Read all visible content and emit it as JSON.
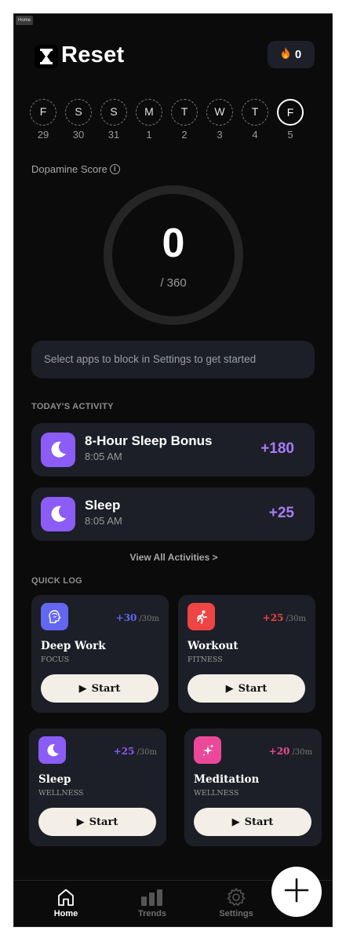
{
  "window_tag": "Home",
  "header": {
    "title": "Reset",
    "streak_count": "0",
    "streak_icon": "fire-icon",
    "logo_icon": "hourglass-icon"
  },
  "week": [
    {
      "letter": "F",
      "date": "29",
      "active": false
    },
    {
      "letter": "S",
      "date": "30",
      "active": false
    },
    {
      "letter": "S",
      "date": "31",
      "active": false
    },
    {
      "letter": "M",
      "date": "1",
      "active": false
    },
    {
      "letter": "T",
      "date": "2",
      "active": false
    },
    {
      "letter": "W",
      "date": "3",
      "active": false
    },
    {
      "letter": "T",
      "date": "4",
      "active": false
    },
    {
      "letter": "F",
      "date": "5",
      "active": true
    }
  ],
  "score": {
    "label": "Dopamine Score",
    "value": "0",
    "max": "/ 360"
  },
  "banner": "Select apps to block in Settings to get started",
  "activity": {
    "heading": "TODAY'S ACTIVITY",
    "items": [
      {
        "title": "8-Hour Sleep Bonus",
        "time": "8:05 AM",
        "points": "+180",
        "icon": "moon-icon"
      },
      {
        "title": "Sleep",
        "time": "8:05 AM",
        "points": "+25",
        "icon": "moon-icon"
      }
    ],
    "view_all": "View All Activities >"
  },
  "quick_log": {
    "heading": "QUICK LOG",
    "items": [
      {
        "title": "Deep Work",
        "category": "FOCUS",
        "points": "+30",
        "per": "/30m",
        "icon": "brain-head-icon",
        "color": "#6366f1",
        "button": "Start"
      },
      {
        "title": "Workout",
        "category": "FITNESS",
        "points": "+25",
        "per": "/30m",
        "icon": "running-icon",
        "color": "#ef4444",
        "button": "Start"
      },
      {
        "title": "Sleep",
        "category": "WELLNESS",
        "points": "+25",
        "per": "/30m",
        "icon": "moon-icon",
        "color": "#8b5cf6",
        "button": "Start"
      },
      {
        "title": "Meditation",
        "category": "WELLNESS",
        "points": "+20",
        "per": "/30m",
        "icon": "sparkle-icon",
        "color": "#ec4899",
        "button": "Start"
      }
    ]
  },
  "tabs": [
    {
      "label": "Home",
      "icon": "home-icon",
      "active": true
    },
    {
      "label": "Trends",
      "icon": "bar-chart-icon",
      "active": false
    },
    {
      "label": "Settings",
      "icon": "gear-icon",
      "active": false
    }
  ],
  "fab": {
    "icon": "plus-icon"
  },
  "colors": {
    "accent": "#8b5cf6",
    "points_purple": "#a87bf7",
    "card_bg": "#1c1f27",
    "page_bg": "#0b0b0b"
  }
}
